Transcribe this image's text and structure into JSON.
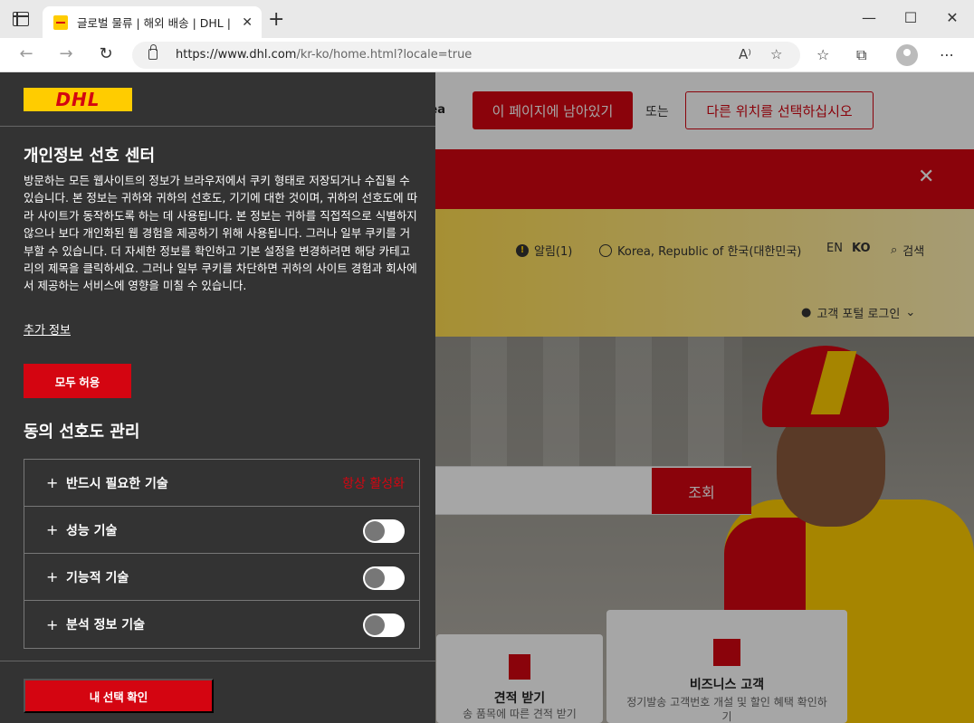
{
  "browser": {
    "tab_title": "글로벌 물류 | 해외 배송 | DHL | K",
    "url_host": "https://www.dhl.com",
    "url_path": "/kr-ko/home.html?locale=true"
  },
  "page": {
    "region_text": "rea",
    "stay_button": "이 페이지에 남아있기",
    "or_text": "또는",
    "other_location_button": "다른 위치를 선택하십시오",
    "alerts_label": "알림(1)",
    "country_label": "Korea, Republic of 한국(대한민국)",
    "lang_en": "EN",
    "lang_ko": "KO",
    "search_label": "검색",
    "customer_login": "고객 포털 로그인",
    "track_button": "조회",
    "quote_card_title": "견적 받기",
    "quote_card_sub": "송 품목에 따른 견적 받기",
    "business_card_title": "비즈니스 고객",
    "business_card_sub": "정기발송 고객번호 개설 및 할인 혜택 확인하기"
  },
  "privacy": {
    "logo_text": "DHL",
    "title": "개인정보 선호 센터",
    "description": "방문하는 모든 웹사이트의 정보가 브라우저에서 쿠키 형태로 저장되거나 수집될 수 있습니다. 본 정보는 귀하와 귀하의 선호도, 기기에 대한 것이며, 귀하의 선호도에 따라 사이트가 동작하도록 하는 데 사용됩니다. 본 정보는 귀하를 직접적으로 식별하지 않으나 보다 개인화된 웹 경험을 제공하기 위해 사용됩니다. 그러나 일부 쿠키를 거부할 수 있습니다. 더 자세한 정보를 확인하고 기본 설정을 변경하려면 해당 카테고리의 제목을 클릭하세요. 그러나 일부 쿠키를 차단하면 귀하의 사이트 경험과 회사에서 제공하는 서비스에 영향을 미칠 수 있습니다.",
    "more_info": "추가 정보",
    "allow_all": "모두 허용",
    "manage_title": "동의 선호도 관리",
    "categories": [
      {
        "label": "반드시 필요한 기술",
        "status": "항상 활성화"
      },
      {
        "label": "성능 기술",
        "enabled": false
      },
      {
        "label": "기능적 기술",
        "enabled": false
      },
      {
        "label": "분석 정보 기술",
        "enabled": false
      }
    ],
    "confirm_button": "내 선택 확인"
  },
  "colors": {
    "dhl_red": "#d40511",
    "dhl_yellow": "#ffcc00",
    "panel_bg": "#333333"
  }
}
